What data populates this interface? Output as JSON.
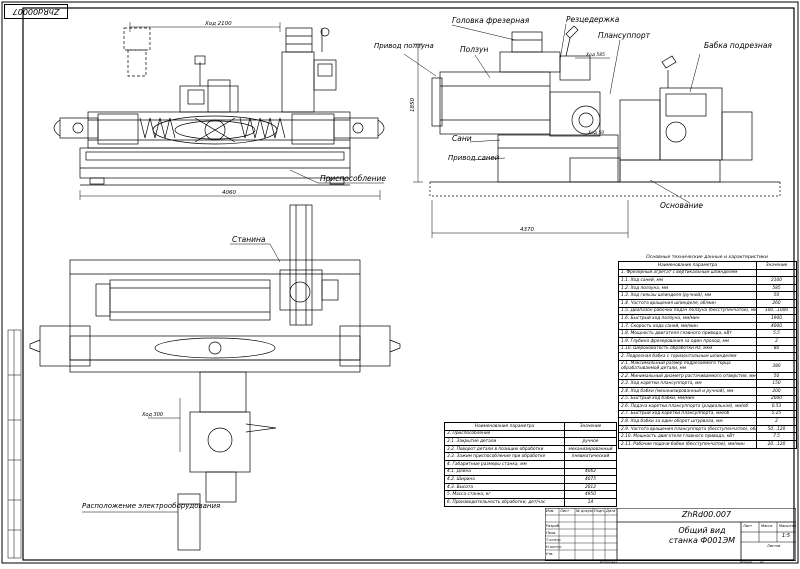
{
  "drawing": {
    "corner_code": "ZhRd00007",
    "title_code": "ZhRd00.007",
    "title": "Общий вид станка Ф001ЭМ",
    "sheet_label": "Лист",
    "sheets_label": "Листов",
    "mass_label": "Масса",
    "scale_label": "Масштаб",
    "scale_value": "1:5",
    "copied_label": "Копировал",
    "format_label": "Формат",
    "format_value": "A1"
  },
  "labels": {
    "milling_head": "Головка фрезерная",
    "ram": "Ползун",
    "ram_drive": "Привод ползуна",
    "cutter_holder": "Резцедержка",
    "planishing": "Плансуппорт",
    "facing_head": "Бабка подрезная",
    "carriage": "Сани",
    "carriage_drive": "Привод саней",
    "base": "Основание",
    "fixture": "Приспособление",
    "bed": "Станина",
    "electro": "Расположение электрооборудования"
  },
  "dims": {
    "travel_2100": "Ход 2100",
    "width_4060": "4060",
    "length_4370": "4370",
    "height_1850": "1850",
    "travel_585": "Ход 585",
    "travel_50": "Ход 50",
    "travel_300": "Ход 300"
  },
  "spec_table": {
    "title": "Основные технические данные и характеристики",
    "header": [
      "Наименование параметра",
      "Значение"
    ],
    "rows": [
      {
        "name": "1. Фрезерный агрегат с вертикальным шпинделем",
        "value": "",
        "section": true
      },
      {
        "name": "1.1. Ход саней, мм",
        "value": "2100"
      },
      {
        "name": "1.2. Ход ползуна, мм",
        "value": "585"
      },
      {
        "name": "1.3. Ход гильзы шпинделя (ручной), мм",
        "value": "50"
      },
      {
        "name": "1.4. Частота вращения шпинделя, об/мин",
        "value": "260"
      },
      {
        "name": "1.5. Диапазон рабочих подач ползуна (бесступенчатое), мм/мин",
        "value": "100...1000"
      },
      {
        "name": "1.6. Быстрый ход ползуна, мм/мин",
        "value": "1900"
      },
      {
        "name": "1.7. Скорость хода саней, мм/мин",
        "value": "4000"
      },
      {
        "name": "1.8. Мощность двигателя главного привода, кВт",
        "value": "5.5"
      },
      {
        "name": "1.9. Глубина фрезерования за один проход, мм",
        "value": "2"
      },
      {
        "name": "1.10. Шероховатость обработки Rz, мкм",
        "value": "80"
      },
      {
        "name": "2. Подрезная бабка с горизонтальным шпинделем",
        "value": "",
        "section": true
      },
      {
        "name": "2.1. Максимальный размер подрезаемого торца обрабатываемой детали, мм",
        "value": "380",
        "tall": true
      },
      {
        "name": "2.2. Минимальный диаметр растачиваемого отверстия, мм",
        "value": "50"
      },
      {
        "name": "2.3. Ход каретки плансуппорта, мм",
        "value": "150"
      },
      {
        "name": "2.4. Ход бабки (механизированный и ручной), мм",
        "value": "200"
      },
      {
        "name": "2.5. Быстрый ход бабки, мм/мин",
        "value": "2000"
      },
      {
        "name": "2.6. Подача каретки плансуппорта (радиальная), мм/об",
        "value": "0.53"
      },
      {
        "name": "2.7. Быстрый ход каретки плансуппорта, мм/об",
        "value": "5.25"
      },
      {
        "name": "2.8. Ход бабки за один оборот штурвала, мм",
        "value": "2"
      },
      {
        "name": "2.9. Частота вращения плансуппорта (бесступенчатое), об/мин",
        "value": "50...120"
      },
      {
        "name": "2.10. Мощность двигателя главного привода, кВт",
        "value": "7.5"
      },
      {
        "name": "2.11. Рабочие подачи бабки (бесступенчатое), мм/мин",
        "value": "20...120"
      }
    ]
  },
  "param_table": {
    "header": [
      "Наименование параметра",
      "Значение"
    ],
    "rows": [
      {
        "name": "3. Приспособление",
        "value": "",
        "section": true
      },
      {
        "name": "3.1. Закрытие детали",
        "value": "ручное"
      },
      {
        "name": "3.2. Поворот детали в позицию обработки",
        "value": "механизированный"
      },
      {
        "name": "3.3. Зажим приспособления при обработке",
        "value": "пневматический"
      },
      {
        "name": "4. Габаритные размеры станка, мм",
        "value": "",
        "section": true
      },
      {
        "name": "4.1. Длина",
        "value": "4062"
      },
      {
        "name": "4.2. Ширина",
        "value": "4075"
      },
      {
        "name": "4.3. Высота",
        "value": "2012"
      },
      {
        "name": "5. Масса станка, кг",
        "value": "4950"
      },
      {
        "name": "6. Производительность обработки, дет/час",
        "value": "14"
      }
    ]
  },
  "stamp": {
    "rows": [
      "Изм.",
      "Лист",
      "№ докум.",
      "Подп.",
      "Дата"
    ],
    "roles": [
      "Разраб.",
      "Пров.",
      "Т.контр.",
      "Н.контр.",
      "Утв."
    ]
  }
}
